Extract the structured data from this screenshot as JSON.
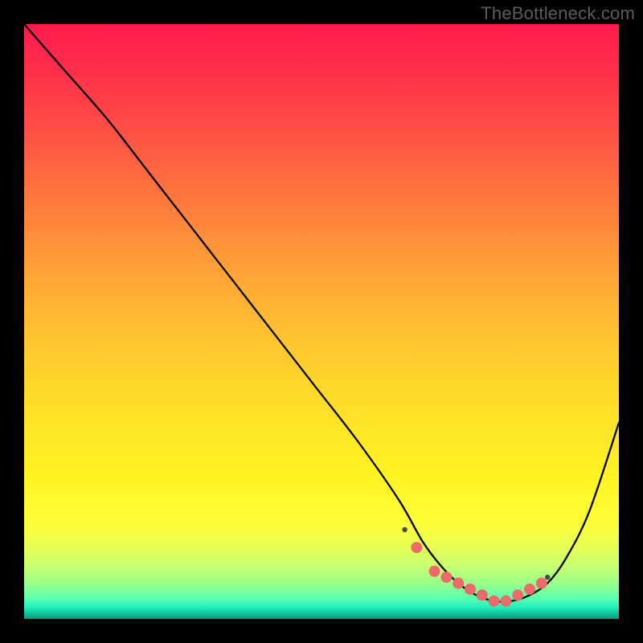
{
  "watermark": "TheBottleneck.com",
  "chart_data": {
    "type": "line",
    "title": "",
    "xlabel": "",
    "ylabel": "",
    "xlim": [
      0,
      100
    ],
    "ylim": [
      0,
      100
    ],
    "series": [
      {
        "name": "bottleneck-curve",
        "x": [
          0,
          7,
          14,
          21,
          28,
          35,
          42,
          49,
          56,
          63,
          67,
          70,
          73,
          76,
          79,
          82,
          85,
          88,
          91,
          95,
          100
        ],
        "values": [
          100,
          92,
          84,
          75,
          66,
          57,
          48,
          39,
          30,
          20,
          13,
          9,
          6,
          4,
          3,
          3,
          4,
          6,
          10,
          18,
          33
        ]
      }
    ],
    "markers": {
      "name": "highlight-minimum",
      "x": [
        66,
        69,
        71,
        73,
        75,
        77,
        79,
        81,
        83,
        85,
        87
      ],
      "values": [
        12,
        8,
        7,
        6,
        5,
        4,
        3,
        3,
        4,
        5,
        6
      ]
    },
    "marker_endpoints": {
      "x": [
        64,
        88
      ],
      "values": [
        15,
        7
      ]
    },
    "background_gradient": {
      "top": "#ff1a4d",
      "mid": "#ffe228",
      "bottom": "#0a9c7a"
    }
  }
}
